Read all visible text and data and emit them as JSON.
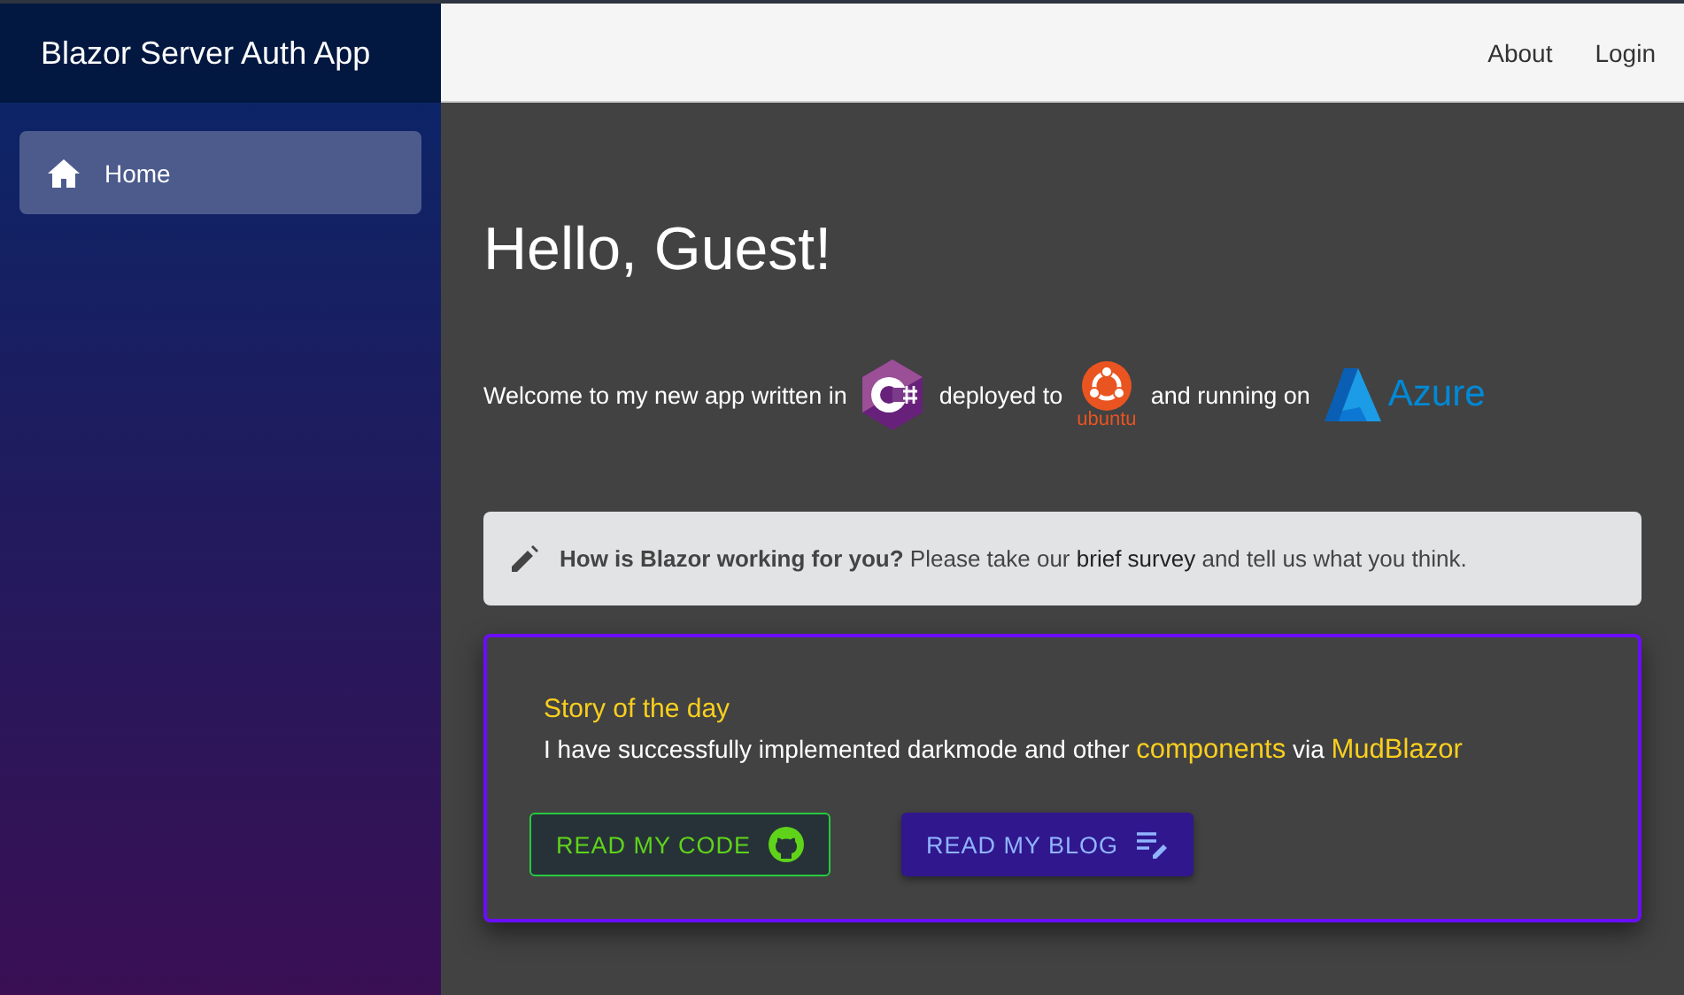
{
  "app_title": "Blazor Server Auth App",
  "nav_items": [
    {
      "label": "Home",
      "selected": true
    }
  ],
  "top_links": [
    "About",
    "Login"
  ],
  "heading": "Hello, Guest!",
  "welcome": {
    "parts": [
      {
        "kind": "text",
        "text": "Welcome to my new app written in"
      },
      {
        "kind": "csharp"
      },
      {
        "kind": "text",
        "text": "deployed to"
      },
      {
        "kind": "ubuntu",
        "text": "ubuntu"
      },
      {
        "kind": "text",
        "text": "and running on"
      },
      {
        "kind": "azure",
        "text": "Azure"
      }
    ]
  },
  "survey": {
    "lead": "How is Blazor working for you?",
    "before": "Please take our",
    "link": "brief survey",
    "after": "and tell us what you think."
  },
  "story": {
    "title": "Story of the day",
    "parts": [
      {
        "kind": "text",
        "text": "I have successfully implemented darkmode and other"
      },
      {
        "kind": "link",
        "text": "components"
      },
      {
        "kind": "text",
        "text": "via"
      },
      {
        "kind": "link",
        "text": "MudBlazor"
      }
    ],
    "buttons": [
      {
        "kind": "code",
        "label": "READ MY CODE"
      },
      {
        "kind": "blog",
        "label": "READ MY BLOG"
      }
    ]
  }
}
